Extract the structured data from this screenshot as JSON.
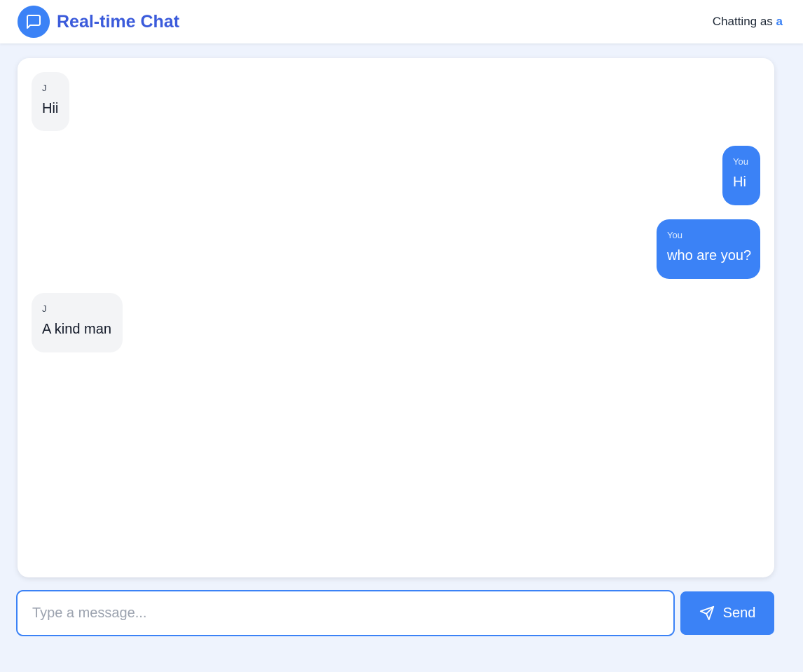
{
  "header": {
    "title": "Real-time Chat",
    "status_prefix": "Chatting as",
    "username": "a",
    "logo_icon": "message-square-icon"
  },
  "messages": [
    {
      "sender": "J",
      "text": "Hii",
      "mine": false
    },
    {
      "sender": "You",
      "text": "Hi",
      "mine": true
    },
    {
      "sender": "You",
      "text": "who are you?",
      "mine": true
    },
    {
      "sender": "J",
      "text": "A kind man",
      "mine": false
    }
  ],
  "composer": {
    "placeholder": "Type a message...",
    "value": "",
    "send_label": "Send",
    "send_icon": "send-icon"
  },
  "colors": {
    "accent": "#3b82f6",
    "title": "#3b5bdb",
    "other_bubble": "#f3f4f6",
    "background": "#eef3fd"
  }
}
